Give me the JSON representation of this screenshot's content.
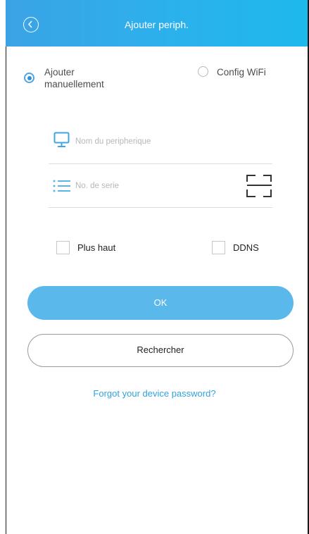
{
  "header": {
    "title": "Ajouter periph."
  },
  "mode": {
    "manual_label": "Ajouter manuellement",
    "manual_line1": "Ajouter",
    "manual_line2": "manuellement",
    "wifi_label": "Config WiFi",
    "selected": "manual"
  },
  "fields": {
    "device_name_placeholder": "Nom du peripherique",
    "serial_placeholder": "No. de serie"
  },
  "options": {
    "advanced_label": "Plus haut",
    "advanced_checked": false,
    "ddns_label": "DDNS",
    "ddns_checked": false
  },
  "actions": {
    "ok_label": "OK",
    "search_label": "Rechercher",
    "forgot_label": "Forgot your device password?"
  },
  "colors": {
    "header_start": "#3ba3e5",
    "header_end": "#1eb8ec",
    "accent": "#2e8fdc",
    "ok_button": "#5ab8ea",
    "link": "#2fa3df"
  },
  "icons": {
    "back": "back-arrow-icon",
    "device_name": "monitor-icon",
    "serial": "list-icon",
    "scan": "qr-scan-icon"
  }
}
